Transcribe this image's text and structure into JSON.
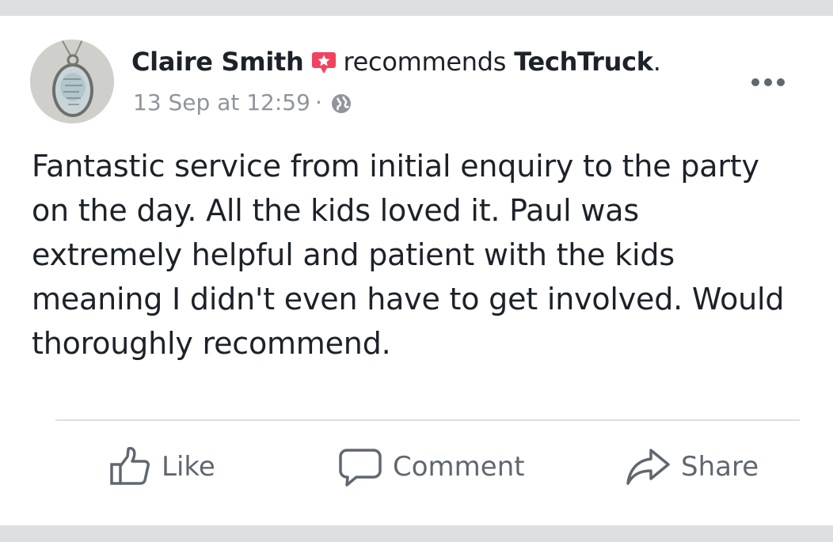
{
  "post": {
    "author": "Claire Smith",
    "action_text": "recommends",
    "page_name": "TechTruck",
    "page_suffix": ".",
    "timestamp": "13 Sep at 12:59",
    "separator": "·",
    "privacy_icon": "globe-icon",
    "recommend_icon": "recommendation-star-icon",
    "body": "Fantastic service from initial enquiry to the party on the day. All the kids loved it. Paul was extremely helpful and patient with the kids meaning I didn't even have to get involved. Would thoroughly recommend."
  },
  "actions": {
    "like_label": "Like",
    "comment_label": "Comment",
    "share_label": "Share"
  },
  "colors": {
    "background": "#dddfe2",
    "card": "#ffffff",
    "text": "#1d2129",
    "secondary_text": "#90949c",
    "action_text": "#606770",
    "recommend_badge": "#f3425f"
  }
}
